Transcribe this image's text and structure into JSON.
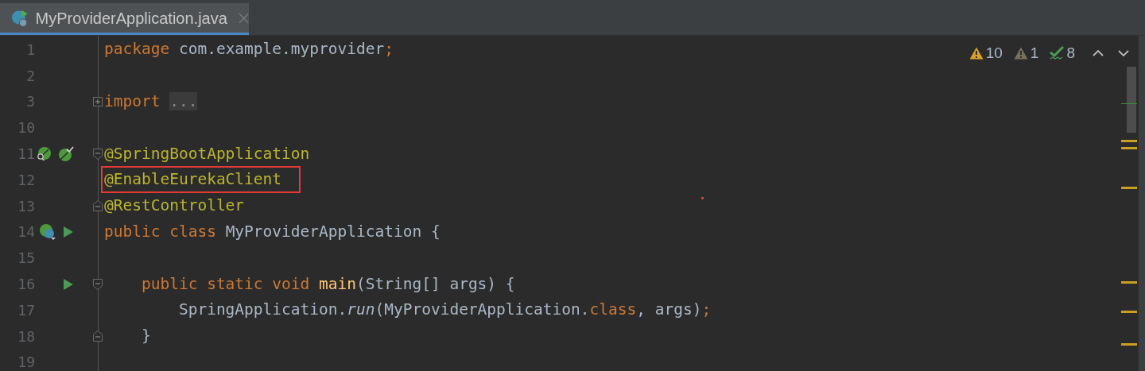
{
  "tab": {
    "title": "MyProviderApplication.java",
    "selected": true
  },
  "inspections": [
    {
      "kind": "warning",
      "count": "10"
    },
    {
      "kind": "weak_warning",
      "count": "1"
    },
    {
      "kind": "typo",
      "count": "8"
    }
  ],
  "lines": [
    {
      "number": "1",
      "tokens": [
        {
          "kind": "keyword",
          "text": "package"
        },
        {
          "kind": "plain",
          "text": " com.example.myprovider"
        },
        {
          "kind": "keyword",
          "text": ";"
        }
      ]
    },
    {
      "number": "2"
    },
    {
      "number": "3",
      "fold": {
        "kind": "collapsed"
      },
      "tokens": [
        {
          "kind": "keyword",
          "text": "import "
        },
        {
          "kind": "folded",
          "text": "..."
        }
      ]
    },
    {
      "number": "10"
    },
    {
      "number": "11",
      "gutter": [
        {
          "kind": "leaf-search"
        },
        {
          "kind": "leaf-check"
        }
      ],
      "fold": {
        "kind": "start"
      },
      "tokens": [
        {
          "kind": "annotation",
          "text": "@SpringBootApplication"
        }
      ]
    },
    {
      "number": "12",
      "highlighted": true,
      "tokens": [
        {
          "kind": "annotation",
          "text": "@EnableEurekaClient"
        }
      ]
    },
    {
      "number": "13",
      "fold": {
        "kind": "end"
      },
      "tokens": [
        {
          "kind": "annotation",
          "text": "@RestController"
        }
      ]
    },
    {
      "number": "14",
      "gutter": [
        {
          "kind": "class-leaf"
        },
        {
          "kind": "run"
        }
      ],
      "tokens": [
        {
          "kind": "keyword",
          "text": "public class"
        },
        {
          "kind": "plain",
          "text": " MyProviderApplication {"
        }
      ]
    },
    {
      "number": "15"
    },
    {
      "number": "16",
      "gutter": [
        {
          "kind": "run"
        }
      ],
      "fold": {
        "kind": "start"
      },
      "tokens": [
        {
          "kind": "keyword",
          "text": "    public static void "
        },
        {
          "kind": "method",
          "text": "main"
        },
        {
          "kind": "plain",
          "text": "(String[] args) {"
        }
      ]
    },
    {
      "number": "17",
      "tokens": [
        {
          "kind": "plain",
          "text": "        SpringApplication."
        },
        {
          "kind": "italic",
          "text": "run"
        },
        {
          "kind": "plain",
          "text": "(MyProviderApplication."
        },
        {
          "kind": "keyword",
          "text": "class"
        },
        {
          "kind": "plain",
          "text": ", args)"
        },
        {
          "kind": "keyword",
          "text": ";"
        }
      ]
    },
    {
      "number": "18",
      "fold": {
        "kind": "end"
      },
      "tokens": [
        {
          "kind": "plain",
          "text": "    }"
        }
      ]
    },
    {
      "number": "19"
    }
  ]
}
